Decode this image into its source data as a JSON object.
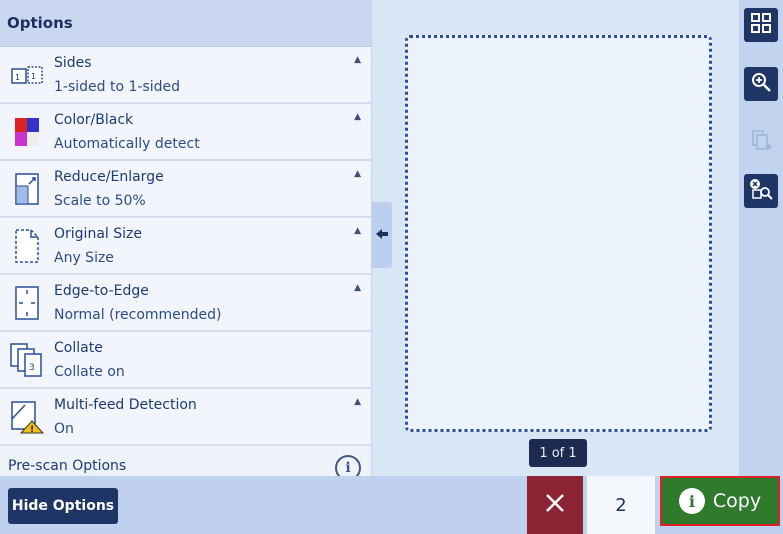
{
  "options": {
    "header": "Options",
    "items": [
      {
        "title": "Sides",
        "value": "1-sided to 1-sided",
        "icon": "sides-icon"
      },
      {
        "title": "Color/Black",
        "value": "Automatically detect",
        "icon": "color-icon"
      },
      {
        "title": "Reduce/Enlarge",
        "value": "Scale to 50%",
        "icon": "reduce-enlarge-icon"
      },
      {
        "title": "Original Size",
        "value": "Any Size",
        "icon": "original-size-icon"
      },
      {
        "title": "Edge-to-Edge",
        "value": "Normal (recommended)",
        "icon": "edge-to-edge-icon"
      },
      {
        "title": "Collate",
        "value": "Collate on",
        "icon": "collate-icon"
      },
      {
        "title": "Multi-feed Detection",
        "value": "On",
        "icon": "multi-feed-icon"
      }
    ],
    "prescan_label": "Pre-scan Options",
    "info_glyph": "i"
  },
  "preview": {
    "page_counter": "1 of 1"
  },
  "bottom": {
    "hide_options_label": "Hide Options",
    "copies": "2",
    "copy_label": "Copy",
    "copy_info_glyph": "i"
  },
  "colors": {
    "accent": "#1f3566",
    "copy_green": "#2f7a2c",
    "cancel_red": "#8c2434",
    "highlight": "#e02020"
  }
}
